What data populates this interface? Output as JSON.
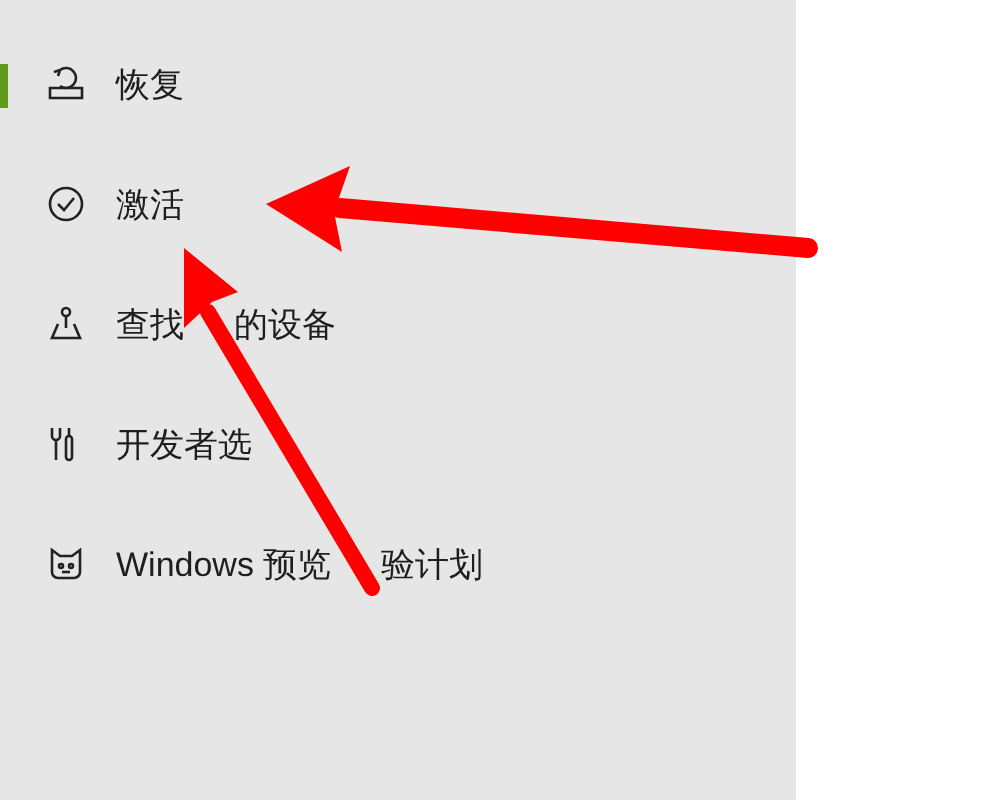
{
  "sidebar": {
    "items": [
      {
        "label": [
          "恢复"
        ],
        "selected": true
      },
      {
        "label": [
          "激活"
        ],
        "selected": false
      },
      {
        "label": [
          "查找",
          "的设备"
        ],
        "selected": false
      },
      {
        "label": [
          "开发者选"
        ],
        "selected": false
      },
      {
        "label": [
          "Windows 预览",
          "验计划"
        ],
        "selected": false
      }
    ]
  }
}
